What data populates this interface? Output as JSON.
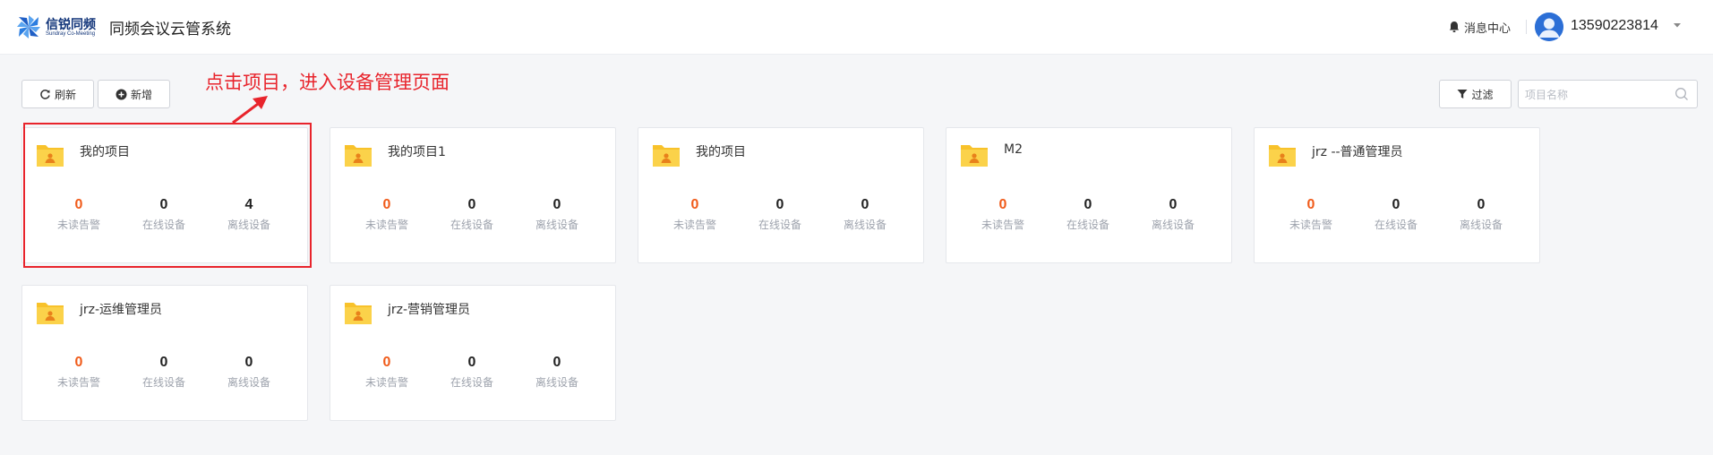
{
  "header": {
    "logo_cn": "信锐同频",
    "logo_en": "Sundray Co-Meeting",
    "app_title": "同频会议云管系统",
    "messages_label": "消息中心",
    "username": "13590223814"
  },
  "toolbar": {
    "refresh_label": "刷新",
    "add_label": "新增",
    "filter_label": "过滤",
    "search_placeholder": "项目名称"
  },
  "annotation": {
    "text": "点击项目，进入设备管理页面",
    "color": "#e8242c"
  },
  "labels": {
    "unread_alarms": "未读告警",
    "online_devices": "在线设备",
    "offline_devices": "离线设备"
  },
  "colors": {
    "alarm": "#f05b1a",
    "folder": "#f8c22b",
    "brand": "#12357a"
  },
  "projects": [
    {
      "name": "我的项目",
      "unread": "0",
      "online": "0",
      "offline": "4"
    },
    {
      "name": "我的项目1",
      "unread": "0",
      "online": "0",
      "offline": "0"
    },
    {
      "name": "我的项目",
      "unread": "0",
      "online": "0",
      "offline": "0"
    },
    {
      "name": "M2",
      "unread": "0",
      "online": "0",
      "offline": "0"
    },
    {
      "name": "jrz --普通管理员",
      "unread": "0",
      "online": "0",
      "offline": "0"
    },
    {
      "name": "jrz-运维管理员",
      "unread": "0",
      "online": "0",
      "offline": "0"
    },
    {
      "name": "jrz-营销管理员",
      "unread": "0",
      "online": "0",
      "offline": "0"
    }
  ]
}
